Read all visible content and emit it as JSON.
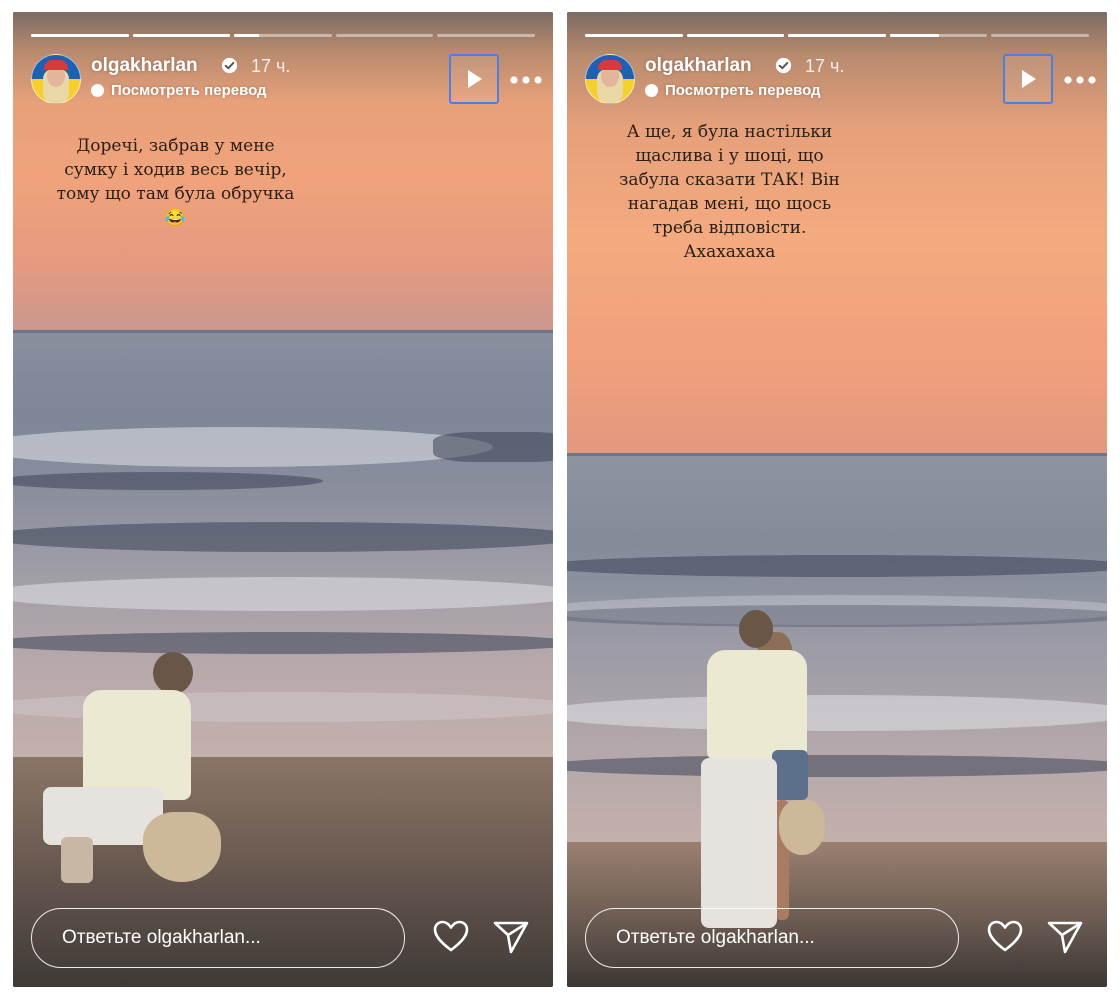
{
  "stories": [
    {
      "username": "olgakharlan",
      "time_ago": "17 ч.",
      "translate_label": "Посмотреть перевод",
      "caption": "Доречі, забрав у мене\nсумку і ходив весь вечір,\nтому що там була обручка\n😂",
      "reply_placeholder": "Ответьте olgakharlan...",
      "progress": [
        1,
        1,
        0.25,
        0,
        0
      ]
    },
    {
      "username": "olgakharlan",
      "time_ago": "17 ч.",
      "translate_label": "Посмотреть перевод",
      "caption": "А ще, я була настільки\nщаслива і у шоці, що\nзабула сказати ТАК! Він\nнагадав мені, що щось\nтреба відповісти.\nАхахахаха",
      "reply_placeholder": "Ответьте olgakharlan...",
      "progress": [
        1,
        1,
        1,
        0.5,
        0
      ]
    }
  ],
  "icons": {
    "play": "play-icon",
    "more": "more-options-icon",
    "like": "heart-icon",
    "share": "send-icon",
    "verified": "verified-badge-icon",
    "translate": "translate-icon"
  },
  "colors": {
    "accent_focus": "#4d7fe0",
    "text_on_image": "#ffffff",
    "caption_text": "#2a2018"
  }
}
